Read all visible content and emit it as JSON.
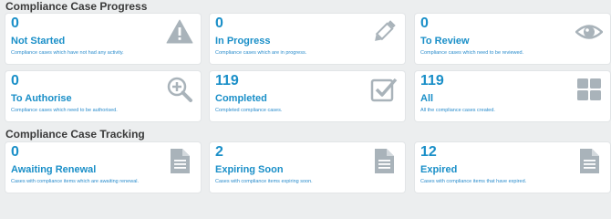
{
  "sections": {
    "progress_title": "Compliance Case Progress",
    "tracking_title": "Compliance Case Tracking"
  },
  "cards": {
    "not_started": {
      "count": "0",
      "label": "Not Started",
      "desc": "Compliance cases which have not had any activity.",
      "icon": "warning-icon"
    },
    "in_progress": {
      "count": "0",
      "label": "In Progress",
      "desc": "Compliance cases which are in progress.",
      "icon": "pencil-icon"
    },
    "to_review": {
      "count": "0",
      "label": "To Review",
      "desc": "Compliance cases which need to be reviewed.",
      "icon": "eye-icon"
    },
    "to_authorise": {
      "count": "0",
      "label": "To Authorise",
      "desc": "Compliance cases which need to be authorised.",
      "icon": "zoom-in-icon"
    },
    "completed": {
      "count": "119",
      "label": "Completed",
      "desc": "Completed compliance cases.",
      "icon": "checkbox-icon"
    },
    "all": {
      "count": "119",
      "label": "All",
      "desc": "All the compliance cases created.",
      "icon": "grid-icon"
    },
    "awaiting_renewal": {
      "count": "0",
      "label": "Awaiting Renewal",
      "desc": "Cases with compliance items which are awaiting renewal.",
      "icon": "document-icon"
    },
    "expiring_soon": {
      "count": "2",
      "label": "Expiring Soon",
      "desc": "Cases with compliance items expiring soon.",
      "icon": "document-icon"
    },
    "expired": {
      "count": "12",
      "label": "Expired",
      "desc": "Cases with compliance items that have expired.",
      "icon": "document-icon"
    }
  },
  "colors": {
    "accent": "#1a8fc8",
    "icon": "#a9b3ba",
    "background": "#eceeef",
    "card": "#ffffff"
  }
}
